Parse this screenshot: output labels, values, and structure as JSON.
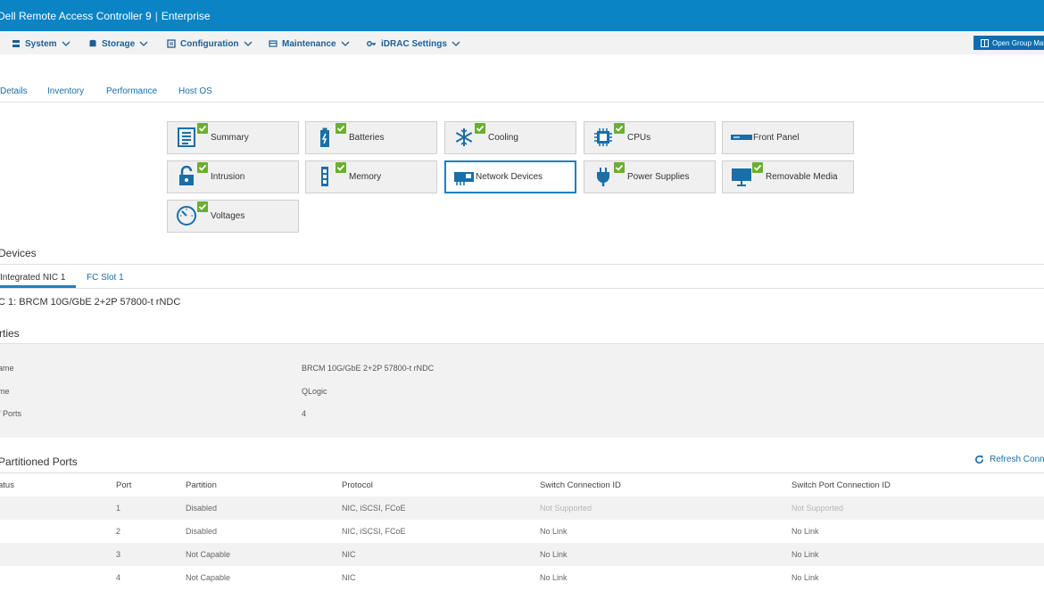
{
  "header": {
    "title": "Dell Remote Access Controller 9",
    "edition": "Enterprise",
    "open_group_label": "Open Group Man"
  },
  "menu": [
    {
      "label": "System",
      "icon": "server-icon"
    },
    {
      "label": "Storage",
      "icon": "database-icon"
    },
    {
      "label": "Configuration",
      "icon": "config-icon"
    },
    {
      "label": "Maintenance",
      "icon": "maintenance-icon"
    },
    {
      "label": "iDRAC Settings",
      "icon": "key-icon"
    }
  ],
  "tabs": [
    "Details",
    "Inventory",
    "Performance",
    "Host OS"
  ],
  "tiles": [
    {
      "label": "Summary",
      "icon": "list-icon",
      "status": "ok"
    },
    {
      "label": "Batteries",
      "icon": "battery-icon",
      "status": "ok"
    },
    {
      "label": "Cooling",
      "icon": "snowflake-icon",
      "status": "ok"
    },
    {
      "label": "CPUs",
      "icon": "chip-icon",
      "status": "ok"
    },
    {
      "label": "Front Panel",
      "icon": "front-panel-icon",
      "status": "none"
    },
    {
      "label": "Intrusion",
      "icon": "lock-icon",
      "status": "ok"
    },
    {
      "label": "Memory",
      "icon": "memory-icon",
      "status": "ok"
    },
    {
      "label": "Network Devices",
      "icon": "network-card-icon",
      "status": "none"
    },
    {
      "label": "Power Supplies",
      "icon": "plug-icon",
      "status": "ok"
    },
    {
      "label": "Removable Media",
      "icon": "monitor-icon",
      "status": "ok"
    },
    {
      "label": "Voltages",
      "icon": "gauge-icon",
      "status": "ok"
    }
  ],
  "devices": {
    "heading": "Devices",
    "tabs": [
      "Integrated NIC 1",
      "FC Slot 1"
    ],
    "nic_title": "C 1: BRCM 10G/GbE 2+2P 57800-t rNDC"
  },
  "properties": {
    "heading": "rties",
    "rows": [
      {
        "key": "ame",
        "value": "BRCM 10G/GbE 2+2P 57800-t rNDC"
      },
      {
        "key": "me",
        "value": "QLogic"
      },
      {
        "key": "f Ports",
        "value": "4"
      }
    ]
  },
  "ports": {
    "heading": "Partitioned Ports",
    "refresh_label": "Refresh Conn",
    "columns": [
      "atus",
      "Port",
      "Partition",
      "Protocol",
      "Switch Connection ID",
      "Switch Port Connection ID"
    ],
    "rows": [
      {
        "port": "1",
        "partition": "Disabled",
        "protocol": "NIC, iSCSI, FCoE",
        "switch_id": "Not Supported",
        "switch_port_id": "Not Supported"
      },
      {
        "port": "2",
        "partition": "Disabled",
        "protocol": "NIC, iSCSI, FCoE",
        "switch_id": "No Link",
        "switch_port_id": "No Link"
      },
      {
        "port": "3",
        "partition": "Not Capable",
        "protocol": "NIC",
        "switch_id": "No Link",
        "switch_port_id": "No Link"
      },
      {
        "port": "4",
        "partition": "Not Capable",
        "protocol": "NIC",
        "switch_id": "No Link",
        "switch_port_id": "No Link"
      }
    ]
  },
  "colors": {
    "brand": "#0a84c4",
    "link": "#1b6ea8",
    "ok": "#6aaf2f",
    "selected_border": "#1f7fc0"
  }
}
